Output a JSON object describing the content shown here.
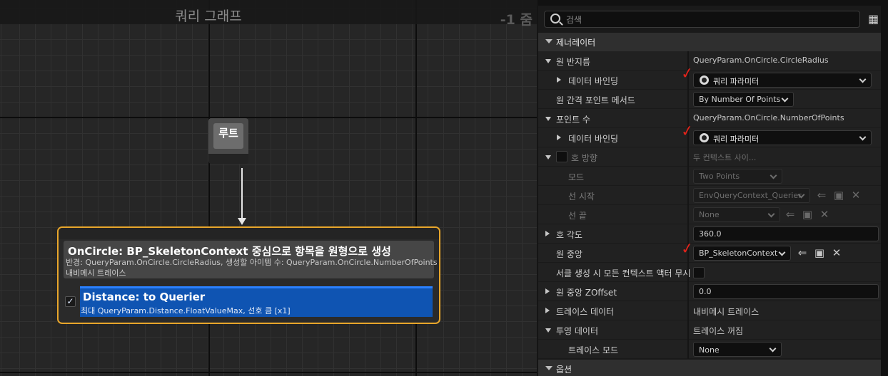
{
  "graph": {
    "title": "쿼리 그래프",
    "zoom": "-1 줌",
    "root_node": {
      "label": "루트"
    },
    "generator_node": {
      "title": "OnCircle: BP_SkeletonContext 중심으로 항목을 원형으로 생성",
      "subtitle": "반경: QueryParam.OnCircle.CircleRadius, 생성할 아이템 수: QueryParam.OnCircle.NumberOfPoints",
      "subtitle2": "내비메시 트레이스",
      "test": {
        "title": "Distance: to Querier",
        "subtitle": "최대 QueryParam.Distance.FloatValueMax, 선호 큼 [x1]",
        "enabled": true
      }
    }
  },
  "details": {
    "search": {
      "placeholder": "검색"
    },
    "categories": {
      "generator": "제너레이터",
      "options": "옵션"
    },
    "rows": {
      "circle_radius": {
        "name": "원 반지름",
        "value": "QueryParam.OnCircle.CircleRadius"
      },
      "binding1": {
        "name": "데이터 바인딩",
        "value": "쿼리 파라미터"
      },
      "spacing_method": {
        "name": "원 간격 포인트 메서드",
        "value": "By Number Of Points"
      },
      "num_points": {
        "name": "포인트 수",
        "value": "QueryParam.OnCircle.NumberOfPoints"
      },
      "binding2": {
        "name": "데이터 바인딩",
        "value": "쿼리 파라미터"
      },
      "arc_direction": {
        "name": "호 방향",
        "value": "두 컨텍스트 사이..."
      },
      "mode": {
        "name": "모드",
        "value": "Two Points"
      },
      "line_from": {
        "name": "선 시작",
        "value": "EnvQueryContext_Querier"
      },
      "line_to": {
        "name": "선 끝",
        "value": "None"
      },
      "arc_angle": {
        "name": "호 각도",
        "value": "360.0"
      },
      "circle_center": {
        "name": "원 중앙",
        "value": "BP_SkeletonContext"
      },
      "ignore_actors": {
        "name": "서클 생성 시 모든 컨텍스트 액터 무시"
      },
      "center_z": {
        "name": "원 중앙 ZOffset",
        "value": "0.0"
      },
      "trace_data": {
        "name": "트레이스 데이터",
        "value": "내비메시 트레이스"
      },
      "projection_data": {
        "name": "투영 데이터",
        "value": "트레이스 꺼짐"
      },
      "trace_mode": {
        "name": "트레이스 모드",
        "value": "None"
      }
    }
  },
  "colors": {
    "accent": "#e8a62b",
    "selection": "#0f54b2",
    "annotation": "#e2231a"
  }
}
